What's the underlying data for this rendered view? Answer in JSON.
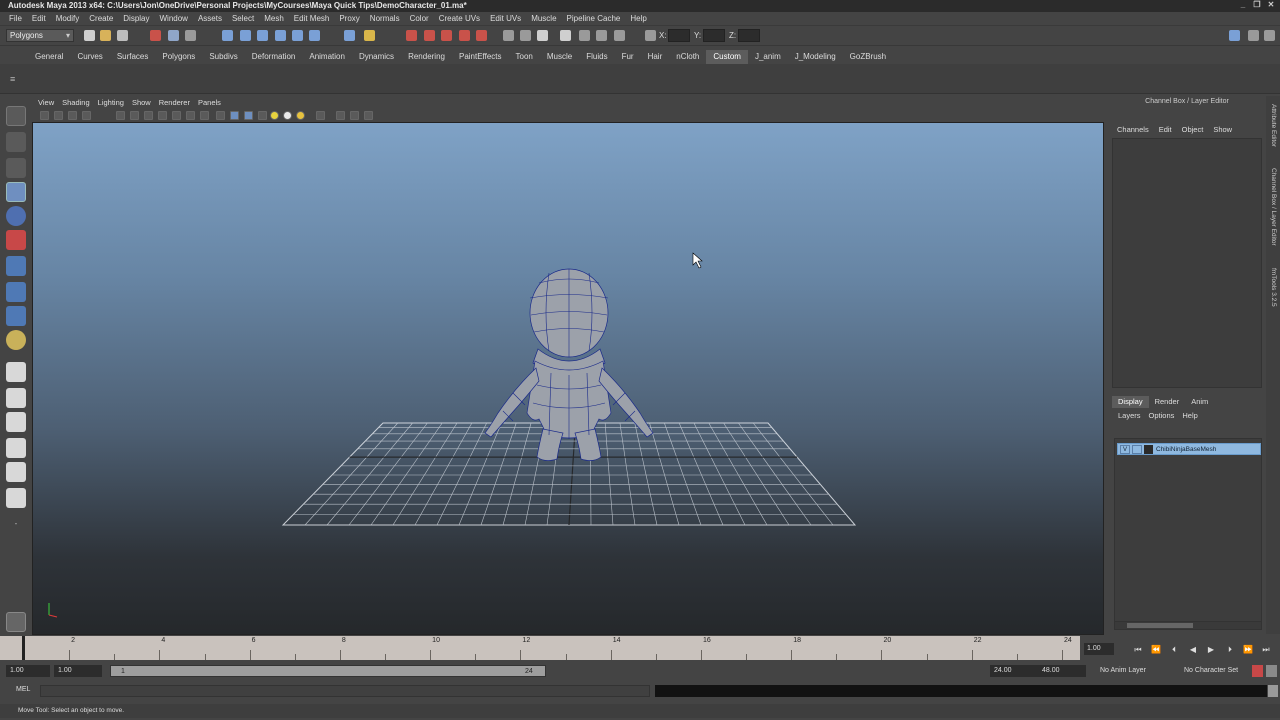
{
  "titlebar": {
    "title": "Autodesk Maya 2013 x64: C:\\Users\\Jon\\OneDrive\\Personal Projects\\MyCourses\\Maya Quick Tips\\DemoCharacter_01.ma*"
  },
  "menubar": {
    "items": [
      "File",
      "Edit",
      "Modify",
      "Create",
      "Display",
      "Window",
      "Assets",
      "Select",
      "Mesh",
      "Edit Mesh",
      "Proxy",
      "Normals",
      "Color",
      "Create UVs",
      "Edit UVs",
      "Muscle",
      "Pipeline Cache",
      "Help"
    ]
  },
  "statusline": {
    "mode": "Polygons",
    "x_label": "X:",
    "y_label": "Y:",
    "z_label": "Z:"
  },
  "shelf_tabs": {
    "items": [
      "General",
      "Curves",
      "Surfaces",
      "Polygons",
      "Subdivs",
      "Deformation",
      "Animation",
      "Dynamics",
      "Rendering",
      "PaintEffects",
      "Toon",
      "Muscle",
      "Fluids",
      "Fur",
      "Hair",
      "nCloth",
      "Custom",
      "J_anim",
      "J_Modeling",
      "GoZBrush"
    ],
    "active": "Custom"
  },
  "viewport_menu": {
    "items": [
      "View",
      "Shading",
      "Lighting",
      "Show",
      "Renderer",
      "Panels"
    ]
  },
  "channel_box": {
    "title": "Channel Box / Layer Editor",
    "menu": [
      "Channels",
      "Edit",
      "Object",
      "Show"
    ]
  },
  "layer_editor": {
    "tabs": [
      "Display",
      "Render",
      "Anim"
    ],
    "active_tab": "Display",
    "menu": [
      "Layers",
      "Options",
      "Help"
    ],
    "layers": [
      {
        "visible": "V",
        "name": "ChibiNinjaBaseMesh"
      }
    ]
  },
  "side_tabs": [
    "Attribute Editor",
    "Channel Box / Layer Editor",
    "fmTools 3.2.5"
  ],
  "timeline": {
    "ticks": [
      1,
      2,
      3,
      4,
      5,
      6,
      7,
      8,
      9,
      10,
      11,
      12,
      13,
      14,
      15,
      16,
      17,
      18,
      19,
      20,
      21,
      22,
      23,
      24
    ],
    "labels": [
      "2",
      "4",
      "6",
      "8",
      "10",
      "12",
      "14",
      "16",
      "18",
      "20",
      "22",
      "24"
    ],
    "current_frame": "1.00"
  },
  "range": {
    "start": "1.00",
    "playback_start": "1.00",
    "slider_start": "1",
    "slider_end": "24",
    "playback_end": "24.00",
    "end": "48.00",
    "anim_layer": "No Anim Layer",
    "character_set": "No Character Set"
  },
  "cmdline": {
    "label": "MEL"
  },
  "helpline": {
    "text": "Move Tool: Select an object to move."
  },
  "colors": {
    "accent_tab": "#5c5c5c",
    "layer_highlight": "#8fb9e0",
    "wireframe": "#1a2a8a",
    "mesh": "#9a9fa8"
  }
}
